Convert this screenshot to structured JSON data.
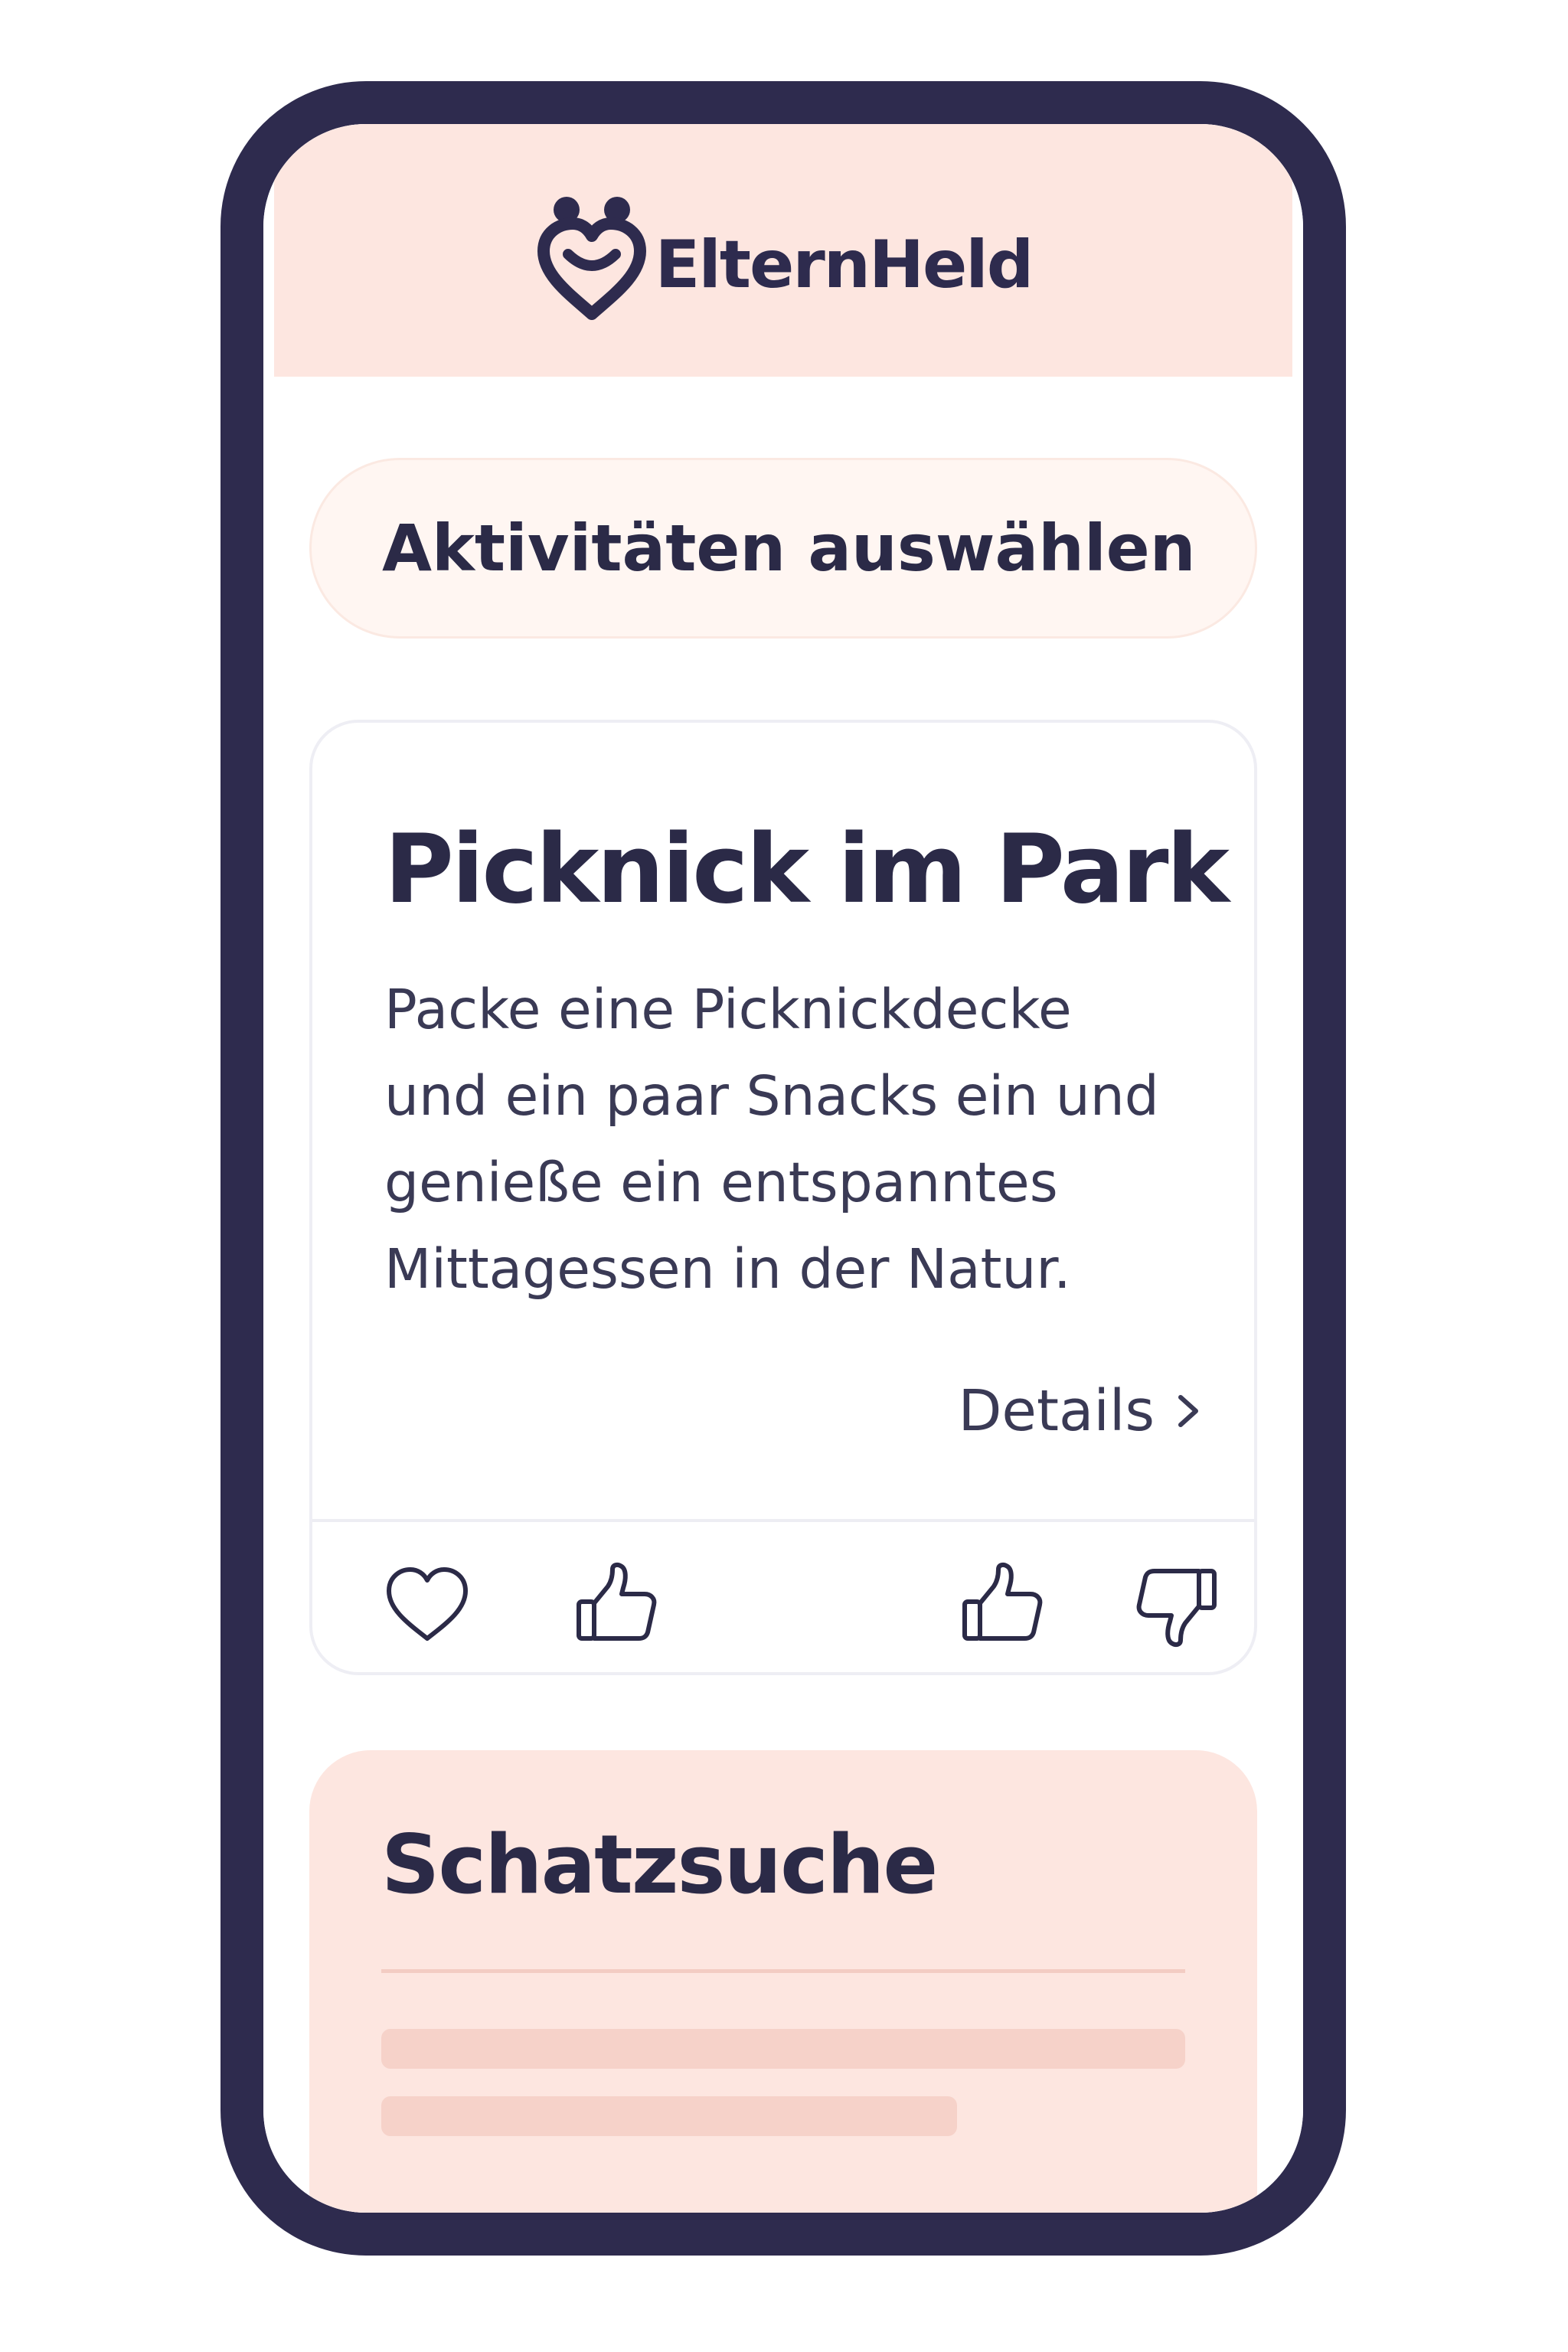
{
  "app": {
    "name": "ElternHeld",
    "logo_icon": "heart-smile-logo-icon"
  },
  "colors": {
    "frame": "#2e2b4e",
    "header_bg": "#fde6e0",
    "text_primary": "#2b2a47",
    "card_border": "#eeeef4"
  },
  "activity_selector": {
    "label": "Aktivitäten auswählen"
  },
  "activity_card": {
    "title": "Picknick im Park",
    "description": "Packe eine Picknickdecke\nund ein paar Snacks ein und\ngenieße ein entspanntes\nMittagessen in der Natur.",
    "details_label": "Details",
    "details_icon": "chevron-right-icon",
    "actions": [
      {
        "icon": "heart-outline-icon"
      },
      {
        "icon": "thumbs-up-outline-icon"
      },
      {
        "icon": "thumbs-up-outline-icon"
      },
      {
        "icon": "thumbs-down-outline-icon"
      }
    ]
  },
  "next_card": {
    "title": "Schatzsuche"
  }
}
